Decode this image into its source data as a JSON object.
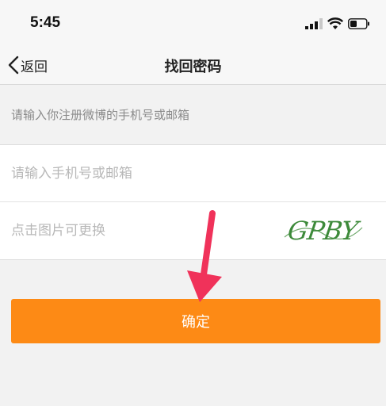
{
  "status_bar": {
    "time": "5:45",
    "icons": [
      "signal-icon",
      "wifi-icon",
      "battery-icon"
    ]
  },
  "nav": {
    "back_label": "返回",
    "title": "找回密码"
  },
  "form": {
    "hint": "请输入你注册微博的手机号或邮箱",
    "account_placeholder": "请输入手机号或邮箱",
    "captcha_placeholder": "点击图片可更换",
    "captcha_text": "GPBY"
  },
  "confirm_label": "确定",
  "colors": {
    "accent": "#fd8a15",
    "annotation_arrow": "#f0325a",
    "captcha_green": "#3d8a3a"
  }
}
